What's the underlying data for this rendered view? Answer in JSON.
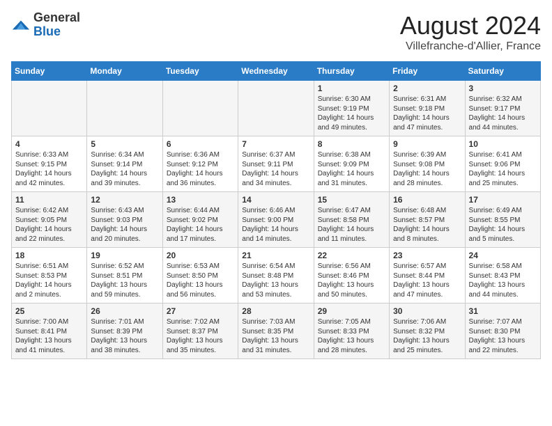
{
  "header": {
    "logo_general": "General",
    "logo_blue": "Blue",
    "month_title": "August 2024",
    "location": "Villefranche-d'Allier, France"
  },
  "weekdays": [
    "Sunday",
    "Monday",
    "Tuesday",
    "Wednesday",
    "Thursday",
    "Friday",
    "Saturday"
  ],
  "weeks": [
    [
      {
        "day": "",
        "info": ""
      },
      {
        "day": "",
        "info": ""
      },
      {
        "day": "",
        "info": ""
      },
      {
        "day": "",
        "info": ""
      },
      {
        "day": "1",
        "info": "Sunrise: 6:30 AM\nSunset: 9:19 PM\nDaylight: 14 hours and 49 minutes."
      },
      {
        "day": "2",
        "info": "Sunrise: 6:31 AM\nSunset: 9:18 PM\nDaylight: 14 hours and 47 minutes."
      },
      {
        "day": "3",
        "info": "Sunrise: 6:32 AM\nSunset: 9:17 PM\nDaylight: 14 hours and 44 minutes."
      }
    ],
    [
      {
        "day": "4",
        "info": "Sunrise: 6:33 AM\nSunset: 9:15 PM\nDaylight: 14 hours and 42 minutes."
      },
      {
        "day": "5",
        "info": "Sunrise: 6:34 AM\nSunset: 9:14 PM\nDaylight: 14 hours and 39 minutes."
      },
      {
        "day": "6",
        "info": "Sunrise: 6:36 AM\nSunset: 9:12 PM\nDaylight: 14 hours and 36 minutes."
      },
      {
        "day": "7",
        "info": "Sunrise: 6:37 AM\nSunset: 9:11 PM\nDaylight: 14 hours and 34 minutes."
      },
      {
        "day": "8",
        "info": "Sunrise: 6:38 AM\nSunset: 9:09 PM\nDaylight: 14 hours and 31 minutes."
      },
      {
        "day": "9",
        "info": "Sunrise: 6:39 AM\nSunset: 9:08 PM\nDaylight: 14 hours and 28 minutes."
      },
      {
        "day": "10",
        "info": "Sunrise: 6:41 AM\nSunset: 9:06 PM\nDaylight: 14 hours and 25 minutes."
      }
    ],
    [
      {
        "day": "11",
        "info": "Sunrise: 6:42 AM\nSunset: 9:05 PM\nDaylight: 14 hours and 22 minutes."
      },
      {
        "day": "12",
        "info": "Sunrise: 6:43 AM\nSunset: 9:03 PM\nDaylight: 14 hours and 20 minutes."
      },
      {
        "day": "13",
        "info": "Sunrise: 6:44 AM\nSunset: 9:02 PM\nDaylight: 14 hours and 17 minutes."
      },
      {
        "day": "14",
        "info": "Sunrise: 6:46 AM\nSunset: 9:00 PM\nDaylight: 14 hours and 14 minutes."
      },
      {
        "day": "15",
        "info": "Sunrise: 6:47 AM\nSunset: 8:58 PM\nDaylight: 14 hours and 11 minutes."
      },
      {
        "day": "16",
        "info": "Sunrise: 6:48 AM\nSunset: 8:57 PM\nDaylight: 14 hours and 8 minutes."
      },
      {
        "day": "17",
        "info": "Sunrise: 6:49 AM\nSunset: 8:55 PM\nDaylight: 14 hours and 5 minutes."
      }
    ],
    [
      {
        "day": "18",
        "info": "Sunrise: 6:51 AM\nSunset: 8:53 PM\nDaylight: 14 hours and 2 minutes."
      },
      {
        "day": "19",
        "info": "Sunrise: 6:52 AM\nSunset: 8:51 PM\nDaylight: 13 hours and 59 minutes."
      },
      {
        "day": "20",
        "info": "Sunrise: 6:53 AM\nSunset: 8:50 PM\nDaylight: 13 hours and 56 minutes."
      },
      {
        "day": "21",
        "info": "Sunrise: 6:54 AM\nSunset: 8:48 PM\nDaylight: 13 hours and 53 minutes."
      },
      {
        "day": "22",
        "info": "Sunrise: 6:56 AM\nSunset: 8:46 PM\nDaylight: 13 hours and 50 minutes."
      },
      {
        "day": "23",
        "info": "Sunrise: 6:57 AM\nSunset: 8:44 PM\nDaylight: 13 hours and 47 minutes."
      },
      {
        "day": "24",
        "info": "Sunrise: 6:58 AM\nSunset: 8:43 PM\nDaylight: 13 hours and 44 minutes."
      }
    ],
    [
      {
        "day": "25",
        "info": "Sunrise: 7:00 AM\nSunset: 8:41 PM\nDaylight: 13 hours and 41 minutes."
      },
      {
        "day": "26",
        "info": "Sunrise: 7:01 AM\nSunset: 8:39 PM\nDaylight: 13 hours and 38 minutes."
      },
      {
        "day": "27",
        "info": "Sunrise: 7:02 AM\nSunset: 8:37 PM\nDaylight: 13 hours and 35 minutes."
      },
      {
        "day": "28",
        "info": "Sunrise: 7:03 AM\nSunset: 8:35 PM\nDaylight: 13 hours and 31 minutes."
      },
      {
        "day": "29",
        "info": "Sunrise: 7:05 AM\nSunset: 8:33 PM\nDaylight: 13 hours and 28 minutes."
      },
      {
        "day": "30",
        "info": "Sunrise: 7:06 AM\nSunset: 8:32 PM\nDaylight: 13 hours and 25 minutes."
      },
      {
        "day": "31",
        "info": "Sunrise: 7:07 AM\nSunset: 8:30 PM\nDaylight: 13 hours and 22 minutes."
      }
    ]
  ]
}
